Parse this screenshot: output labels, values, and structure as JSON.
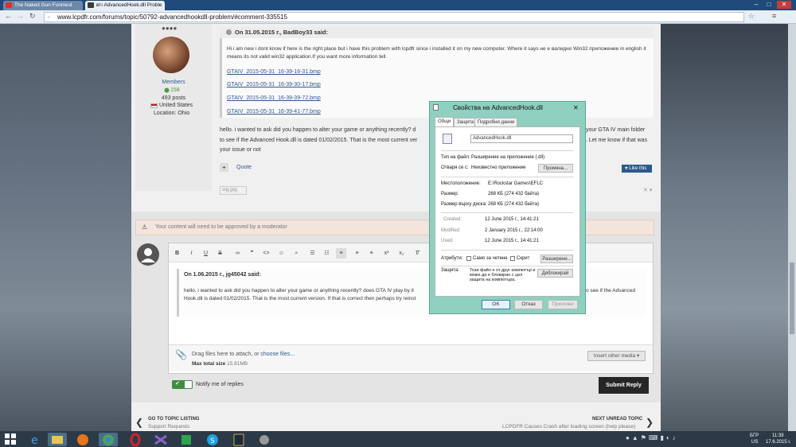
{
  "browser": {
    "tabs": [
      {
        "title": "The Naked Gun Funniest",
        "icon_color": "#e52d27"
      },
      {
        "title": "втı AdvancedHook.dll Proble",
        "icon_color": "#3b3b3b"
      }
    ],
    "url": "www.lcpdfr.com/forums/topic/50792-advancedhookdll-problem/#comment-335515"
  },
  "author": {
    "dots": "●●●●",
    "group": "Members",
    "rep": "158",
    "posts": "493 posts",
    "country": "United States",
    "location": "Location: Ohio"
  },
  "post": {
    "quote_header": "On 31.05.2015 г.,  BadBoy33 said:",
    "quote_body": "Hi i am new i dont know if here is the right place but i have this problem with lcpdfr since i installed it on my new computer. Where it says не е валидно Win32 приложение in english it means its not valid win32 application.If you want more information tell.",
    "attachments": [
      "GTAIV_2015-05-31_16-39-16-31.bmp",
      "GTAIV_2015-05-31_16-39-30-17.bmp",
      "GTAIV_2015-05-31_16-39-39-72.bmp",
      "GTAIV_2015-05-31_16-39-41-77.bmp"
    ],
    "body_line1": "hello. i wanted to ask did you happen to alter your game or anything recently? d",
    "body_line1_end": "your GTA IV main folder",
    "body_line2": "to see if the Advanced Hook.dll is dated 01/02/2015. That is the most current ver",
    "body_line2_end": ". Let me know if that was",
    "body_line3": "your issue or not",
    "quote_action": "Quote",
    "like_label": "Like this",
    "sig": "sig.jpg"
  },
  "reply": {
    "moderation_notice": "Your content will need to be approved by a moderator",
    "quote_header": "On 1.06.2015 г.,  jg45042 said:",
    "quote_body1": "hello. i wanted to ask did you happen to alter your game or anything recently? does GTA IV play by it",
    "quote_body1_end": "o see if the Advanced",
    "quote_body2": "Hook.dll is dated 01/02/2015. That is the most current version. If that is correct then perhaps try reinst",
    "drag_text": "Drag files here to attach, or ",
    "choose_files": "choose files...",
    "max_size": "Max total size ",
    "max_size_value": "15.81MB",
    "insert_media": "Insert other media ▾",
    "notify": "Notify me of replies",
    "submit": "Submit Reply"
  },
  "nav": {
    "prev_label": "GO TO TOPIC LISTING",
    "prev_sub": "Support Requests",
    "next_label": "NEXT UNREAD TOPIC",
    "next_sub": "LCPDFR Causes Crash after loading screen (help please)"
  },
  "dialog": {
    "title": "Свойства на AdvancedHook.dll",
    "tabs": [
      "Общи",
      "Защита",
      "Подробни данни"
    ],
    "filename": "AdvancedHook.dll",
    "type_label": "Тип на файл:",
    "type_value": "Разширение на приложение (.dll)",
    "opens_label": "Отваря се с:",
    "opens_value": "Неизвестно приложение",
    "change_btn": "Промяна...",
    "location_label": "Местоположение:",
    "location_value": "E:\\Rockstar Games\\EFLC",
    "size_label": "Размер:",
    "size_value": "268 КБ (274 432 байта)",
    "disk_label": "Размер върху диска:",
    "disk_value": "268 КБ (274 432 байта)",
    "created_label": "Created:",
    "created_value": "12 June 2015 г., 14:41:21",
    "modified_label": "Modified:",
    "modified_value": "2 January 2015 г., 22:14:00",
    "used_label": "Used:",
    "used_value": "12 June 2015 г., 14:41:21",
    "attr_label": "Атрибути:",
    "readonly": "Само за четене",
    "hidden": "Скрит",
    "advanced_btn": "Разширени...",
    "security_label": "Защита:",
    "security_text": "Този файл е от друг компютър и може да е блокиран с цел защита на компютъра.",
    "unblock_btn": "Деблокирай",
    "ok": "OK",
    "cancel": "Отказ",
    "apply": "Приложи"
  },
  "taskbar": {
    "lang": "БГР",
    "lang2": "US",
    "time": "11:39",
    "date": "17.6.2015 г."
  }
}
